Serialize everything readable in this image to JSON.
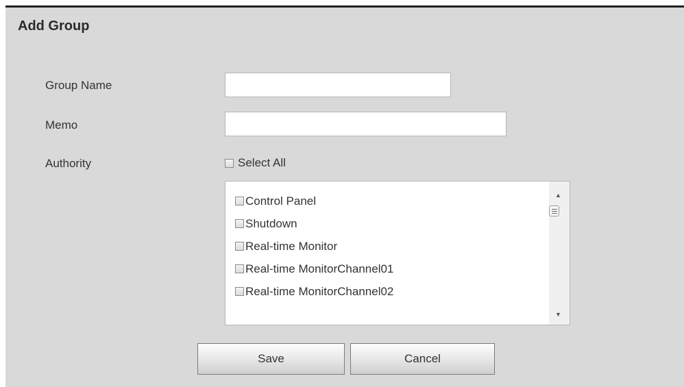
{
  "dialog": {
    "title": "Add Group",
    "fields": {
      "group_name": {
        "label": "Group Name",
        "value": ""
      },
      "memo": {
        "label": "Memo",
        "value": ""
      },
      "authority": {
        "label": "Authority"
      }
    },
    "select_all": {
      "label": "Select All",
      "checked": false
    },
    "authority_list": {
      "items": [
        {
          "label": "Control Panel",
          "checked": false
        },
        {
          "label": "Shutdown",
          "checked": false
        },
        {
          "label": "Real-time Monitor",
          "checked": false
        },
        {
          "label": "Real-time MonitorChannel01",
          "checked": false
        },
        {
          "label": "Real-time MonitorChannel02",
          "checked": false
        }
      ]
    },
    "buttons": {
      "save": "Save",
      "cancel": "Cancel"
    }
  },
  "colors": {
    "panel_bg": "#d9d9d9",
    "top_border": "#1f1f1f",
    "text": "#333333"
  }
}
